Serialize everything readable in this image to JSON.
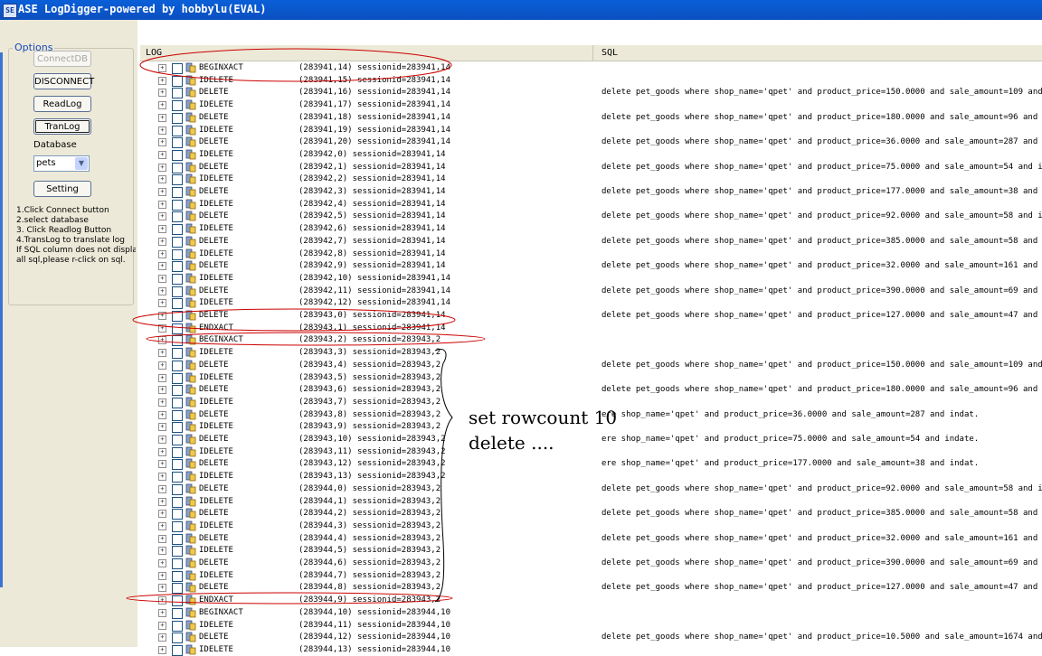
{
  "window": {
    "title": "ASE LogDigger-powered by hobbylu(EVAL)",
    "app_icon": "database-icon"
  },
  "options": {
    "legend": "Options",
    "connect_label": "ConnectDB",
    "disconnect_label": "DISCONNECT",
    "readlog_label": "ReadLog",
    "tranlog_label": "TranLog",
    "database_label": "Database",
    "database_value": "pets",
    "setting_label": "Setting",
    "help": [
      "1.Click Connect button",
      "2.select database",
      "3. Click Readlog Button",
      "4.TransLog to translate log",
      "If SQL column does not display",
      "all sql,please r-click on sql."
    ]
  },
  "grid": {
    "col_log": "LOG",
    "col_sql": "SQL",
    "rows": [
      {
        "op": "BEGINXACT",
        "lsn": "(283941,14)",
        "sess": "sessionid=283941,14",
        "sql": ""
      },
      {
        "op": "IDELETE",
        "lsn": "(283941,15)",
        "sess": "sessionid=283941,14",
        "sql": ""
      },
      {
        "op": "DELETE",
        "lsn": "(283941,16)",
        "sess": "sessionid=283941,14",
        "sql": "delete pet_goods where shop_name='qpet' and product_price=150.0000 and sale_amount=109 and inda."
      },
      {
        "op": "IDELETE",
        "lsn": "(283941,17)",
        "sess": "sessionid=283941,14",
        "sql": ""
      },
      {
        "op": "DELETE",
        "lsn": "(283941,18)",
        "sess": "sessionid=283941,14",
        "sql": "delete pet_goods where shop_name='qpet' and product_price=180.0000 and sale_amount=96 and indat."
      },
      {
        "op": "IDELETE",
        "lsn": "(283941,19)",
        "sess": "sessionid=283941,14",
        "sql": ""
      },
      {
        "op": "DELETE",
        "lsn": "(283941,20)",
        "sess": "sessionid=283941,14",
        "sql": "delete pet_goods where shop_name='qpet' and product_price=36.0000 and sale_amount=287 and indat."
      },
      {
        "op": "IDELETE",
        "lsn": "(283942,0)",
        "sess": "sessionid=283941,14",
        "sql": ""
      },
      {
        "op": "DELETE",
        "lsn": "(283942,1)",
        "sess": "sessionid=283941,14",
        "sql": "delete pet_goods where shop_name='qpet' and product_price=75.0000 and sale_amount=54 and indate."
      },
      {
        "op": "IDELETE",
        "lsn": "(283942,2)",
        "sess": "sessionid=283941,14",
        "sql": ""
      },
      {
        "op": "DELETE",
        "lsn": "(283942,3)",
        "sess": "sessionid=283941,14",
        "sql": "delete pet_goods where shop_name='qpet' and product_price=177.0000 and sale_amount=38 and indat."
      },
      {
        "op": "IDELETE",
        "lsn": "(283942,4)",
        "sess": "sessionid=283941,14",
        "sql": ""
      },
      {
        "op": "DELETE",
        "lsn": "(283942,5)",
        "sess": "sessionid=283941,14",
        "sql": "delete pet_goods where shop_name='qpet' and product_price=92.0000 and sale_amount=58 and indate."
      },
      {
        "op": "IDELETE",
        "lsn": "(283942,6)",
        "sess": "sessionid=283941,14",
        "sql": ""
      },
      {
        "op": "DELETE",
        "lsn": "(283942,7)",
        "sess": "sessionid=283941,14",
        "sql": "delete pet_goods where shop_name='qpet' and product_price=385.0000 and sale_amount=58 and indat."
      },
      {
        "op": "IDELETE",
        "lsn": "(283942,8)",
        "sess": "sessionid=283941,14",
        "sql": ""
      },
      {
        "op": "DELETE",
        "lsn": "(283942,9)",
        "sess": "sessionid=283941,14",
        "sql": "delete pet_goods where shop_name='qpet' and product_price=32.0000 and sale_amount=161 and indat."
      },
      {
        "op": "IDELETE",
        "lsn": "(283942,10)",
        "sess": "sessionid=283941,14",
        "sql": ""
      },
      {
        "op": "DELETE",
        "lsn": "(283942,11)",
        "sess": "sessionid=283941,14",
        "sql": "delete pet_goods where shop_name='qpet' and product_price=390.0000 and sale_amount=69 and indat."
      },
      {
        "op": "IDELETE",
        "lsn": "(283942,12)",
        "sess": "sessionid=283941,14",
        "sql": ""
      },
      {
        "op": "DELETE",
        "lsn": "(283943,0)",
        "sess": "sessionid=283941,14",
        "sql": "delete pet_goods where shop_name='qpet' and product_price=127.0000 and sale_amount=47 and indat."
      },
      {
        "op": "ENDXACT",
        "lsn": "(283943,1)",
        "sess": "sessionid=283941,14",
        "sql": ""
      },
      {
        "op": "BEGINXACT",
        "lsn": "(283943,2)",
        "sess": "sessionid=283943,2",
        "sql": ""
      },
      {
        "op": "IDELETE",
        "lsn": "(283943,3)",
        "sess": "sessionid=283943,2",
        "sql": ""
      },
      {
        "op": "DELETE",
        "lsn": "(283943,4)",
        "sess": "sessionid=283943,2",
        "sql": "delete pet_goods where shop_name='qpet' and product_price=150.0000 and sale_amount=109 and inda."
      },
      {
        "op": "IDELETE",
        "lsn": "(283943,5)",
        "sess": "sessionid=283943,2",
        "sql": ""
      },
      {
        "op": "DELETE",
        "lsn": "(283943,6)",
        "sess": "sessionid=283943,2",
        "sql": "delete pet_goods where shop_name='qpet' and product_price=180.0000 and sale_amount=96 and indat."
      },
      {
        "op": "IDELETE",
        "lsn": "(283943,7)",
        "sess": "sessionid=283943,2",
        "sql": ""
      },
      {
        "op": "DELETE",
        "lsn": "(283943,8)",
        "sess": "sessionid=283943,2",
        "sql": "ere shop_name='qpet' and product_price=36.0000 and sale_amount=287 and indat."
      },
      {
        "op": "IDELETE",
        "lsn": "(283943,9)",
        "sess": "sessionid=283943,2",
        "sql": ""
      },
      {
        "op": "DELETE",
        "lsn": "(283943,10)",
        "sess": "sessionid=283943,2",
        "sql": "ere shop_name='qpet' and product_price=75.0000 and sale_amount=54 and indate."
      },
      {
        "op": "IDELETE",
        "lsn": "(283943,11)",
        "sess": "sessionid=283943,2",
        "sql": ""
      },
      {
        "op": "DELETE",
        "lsn": "(283943,12)",
        "sess": "sessionid=283943,2",
        "sql": "ere shop_name='qpet' and product_price=177.0000 and sale_amount=38 and indat."
      },
      {
        "op": "IDELETE",
        "lsn": "(283943,13)",
        "sess": "sessionid=283943,2",
        "sql": ""
      },
      {
        "op": "DELETE",
        "lsn": "(283944,0)",
        "sess": "sessionid=283943,2",
        "sql": "delete pet_goods where shop_name='qpet' and product_price=92.0000 and sale_amount=58 and indat."
      },
      {
        "op": "IDELETE",
        "lsn": "(283944,1)",
        "sess": "sessionid=283943,2",
        "sql": ""
      },
      {
        "op": "DELETE",
        "lsn": "(283944,2)",
        "sess": "sessionid=283943,2",
        "sql": "delete pet_goods where shop_name='qpet' and product_price=385.0000 and sale_amount=58 and indat."
      },
      {
        "op": "IDELETE",
        "lsn": "(283944,3)",
        "sess": "sessionid=283943,2",
        "sql": ""
      },
      {
        "op": "DELETE",
        "lsn": "(283944,4)",
        "sess": "sessionid=283943,2",
        "sql": "delete pet_goods where shop_name='qpet' and product_price=32.0000 and sale_amount=161 and indat."
      },
      {
        "op": "IDELETE",
        "lsn": "(283944,5)",
        "sess": "sessionid=283943,2",
        "sql": ""
      },
      {
        "op": "DELETE",
        "lsn": "(283944,6)",
        "sess": "sessionid=283943,2",
        "sql": "delete pet_goods where shop_name='qpet' and product_price=390.0000 and sale_amount=69 and indat."
      },
      {
        "op": "IDELETE",
        "lsn": "(283944,7)",
        "sess": "sessionid=283943,2",
        "sql": ""
      },
      {
        "op": "DELETE",
        "lsn": "(283944,8)",
        "sess": "sessionid=283943,2",
        "sql": "delete pet_goods where shop_name='qpet' and product_price=127.0000 and sale_amount=47 and indat."
      },
      {
        "op": "ENDXACT",
        "lsn": "(283944,9)",
        "sess": "sessionid=283943,2",
        "sql": ""
      },
      {
        "op": "BEGINXACT",
        "lsn": "(283944,10)",
        "sess": "sessionid=283944,10",
        "sql": ""
      },
      {
        "op": "IDELETE",
        "lsn": "(283944,11)",
        "sess": "sessionid=283944,10",
        "sql": ""
      },
      {
        "op": "DELETE",
        "lsn": "(283944,12)",
        "sess": "sessionid=283944,10",
        "sql": "delete pet_goods where shop_name='qpet' and product_price=10.5000 and sale_amount=1674 and inda."
      },
      {
        "op": "IDELETE",
        "lsn": "(283944,13)",
        "sess": "sessionid=283944,10",
        "sql": ""
      }
    ]
  },
  "annotation": {
    "line1": "set rowcount 10",
    "line2": "delete ....",
    "color": "#cc0000"
  }
}
